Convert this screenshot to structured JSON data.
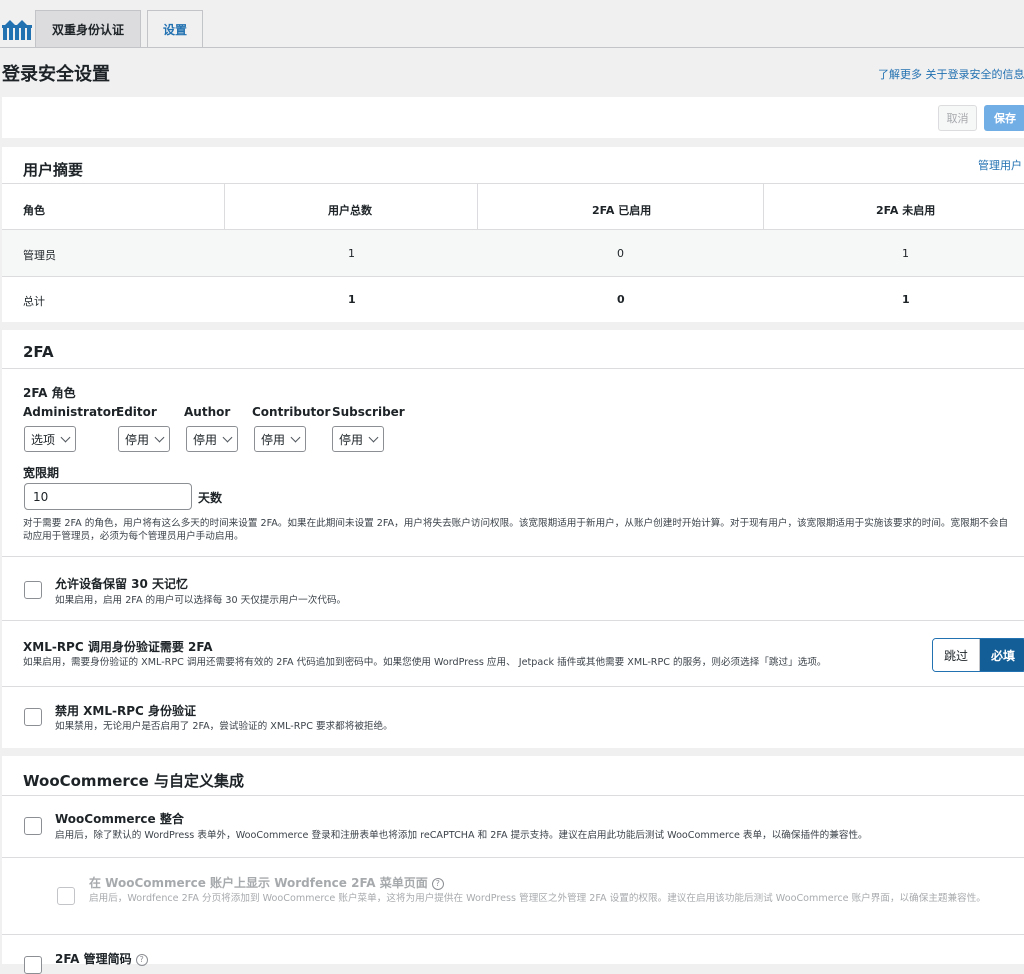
{
  "tabs": [
    {
      "label": "双重身份认证"
    },
    {
      "label": "设置"
    }
  ],
  "page_title": "登录安全设置",
  "learn_more": "了解更多 关于登录安全的信息",
  "actions": {
    "cancel": "取消",
    "save": "保存"
  },
  "user_summary": {
    "title": "用户摘要",
    "manage_link": "管理用户",
    "headers": [
      "角色",
      "用户总数",
      "2FA 已启用",
      "2FA 未启用"
    ],
    "rows": [
      [
        "管理员",
        "1",
        "0",
        "1"
      ],
      [
        "总计",
        "1",
        "0",
        "1"
      ]
    ]
  },
  "twofa": {
    "title": "2FA",
    "roles_label": "2FA 角色",
    "roles": [
      {
        "name": "Administrator",
        "value": "选项"
      },
      {
        "name": "Editor",
        "value": "停用"
      },
      {
        "name": "Author",
        "value": "停用"
      },
      {
        "name": "Contributor",
        "value": "停用"
      },
      {
        "name": "Subscriber",
        "value": "停用"
      }
    ],
    "grace_label": "宽限期",
    "grace_value": "10",
    "grace_unit": "天数",
    "grace_desc": "对于需要 2FA 的角色，用户将有这么多天的时间来设置 2FA。如果在此期间未设置 2FA，用户将失去账户访问权限。该宽限期适用于新用户，从账户创建时开始计算。对于现有用户，该宽限期适用于实施该要求的时间。宽限期不会自动应用于管理员，必须为每个管理员用户手动启用。",
    "remember_label": "允许设备保留 30 天记忆",
    "remember_desc": "如果启用，启用 2FA 的用户可以选择每 30 天仅提示用户一次代码。",
    "xmlrpc_label": "XML-RPC 调用身份验证需要 2FA",
    "xmlrpc_desc": "如果启用，需要身份验证的 XML-RPC 调用还需要将有效的 2FA 代码追加到密码中。如果您使用 WordPress 应用、 Jetpack 插件或其他需要 XML-RPC 的服务，则必须选择「跳过」选项。",
    "xmlrpc_skip": "跳过",
    "xmlrpc_required": "必填",
    "disable_xmlrpc_label": "禁用 XML-RPC 身份验证",
    "disable_xmlrpc_desc": "如果禁用，无论用户是否启用了 2FA，尝试验证的 XML-RPC 要求都将被拒绝。"
  },
  "woo": {
    "title": "WooCommerce 与自定义集成",
    "integration_label": "WooCommerce 整合",
    "integration_desc": "启用后，除了默认的 WordPress 表单外，WooCommerce 登录和注册表单也将添加 reCAPTCHA 和 2FA 提示支持。建议在启用此功能后测试 WooCommerce 表单，以确保插件的兼容性。",
    "menu_label": "在 WooCommerce 账户上显示 Wordfence 2FA 菜单页面",
    "menu_desc": "启用后，Wordfence 2FA 分页将添加到 WooCommerce 账户菜单，这将为用户提供在 WordPress 管理区之外管理 2FA 设置的权限。建议在启用该功能后测试 WooCommerce 账户界面，以确保主题兼容性。",
    "shortcode_label": "2FA 管理简码"
  }
}
